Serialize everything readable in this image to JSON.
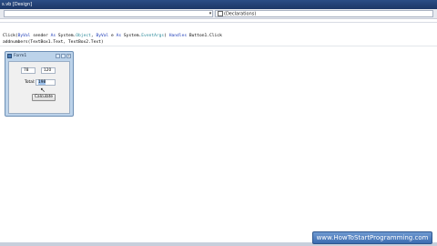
{
  "titlebar": {
    "text": "s.vb [Design]"
  },
  "dropdowns": {
    "right_value": "(Declarations)"
  },
  "code": {
    "line1_a": "Click(",
    "line1_kw1": "ByVal",
    "line1_b": " sender ",
    "line1_kw2": "As",
    "line1_c": " System.",
    "line1_ty1": "Object",
    "line1_d": ", ",
    "line1_kw3": "ByVal",
    "line1_e": " e ",
    "line1_kw4": "As",
    "line1_f": " System.",
    "line1_ty2": "EventArgs",
    "line1_g": ") ",
    "line1_kw5": "Handles",
    "line1_h": " Button1.Click",
    "line2": "addnumbers(TextBox1.Text, TextBox2.Text)"
  },
  "form": {
    "title": "Form1",
    "textbox1": "78",
    "textbox2": "120",
    "total_label": "Total:",
    "total_value": "198",
    "button": "Calculate"
  },
  "watermark": "www.HowToStartProgramming.com"
}
